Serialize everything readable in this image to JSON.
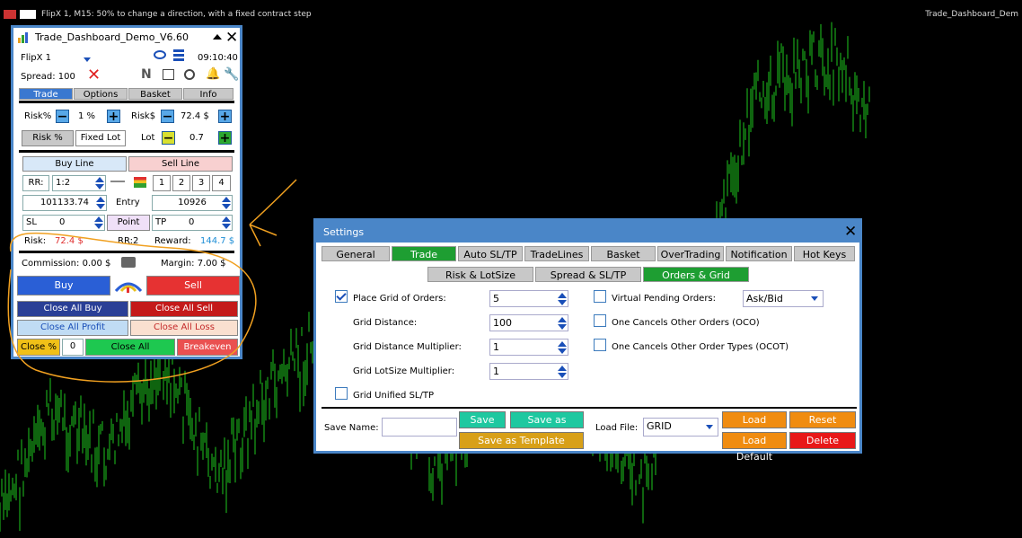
{
  "topbar": {
    "chart_title": "FlipX 1, M15: 50% to change a direction, with a fixed contract step",
    "right_label": "Trade_Dashboard_Dem"
  },
  "dashboard": {
    "title": "Trade_Dashboard_Demo_V6.60",
    "symbol": "FlipX 1",
    "time": "09:10:40",
    "spread": "Spread: 100",
    "news_icon": "N",
    "tabs": [
      "Trade",
      "Options",
      "Basket",
      "Info"
    ],
    "risk_pct_label": "Risk%",
    "risk_pct_value": "1 %",
    "risk_usd_label": "Risk$",
    "risk_usd_value": "72.4 $",
    "risk_mode_pct": "Risk %",
    "risk_mode_fixed": "Fixed Lot",
    "lot_label": "Lot",
    "lot_value": "0.7",
    "buy_line": "Buy Line",
    "sell_line": "Sell Line",
    "rr_label": "RR:",
    "rr_value": "1:2",
    "rr_buttons": [
      "1",
      "2",
      "3",
      "4"
    ],
    "entry_price": "101133.74",
    "entry_label": "Entry",
    "entry_right": "10926",
    "sl_label": "SL",
    "sl_value": "0",
    "point_label": "Point",
    "tp_label": "TP",
    "tp_value": "0",
    "risk_info_label": "Risk:",
    "risk_info_value": "72.4 $",
    "rr_info": "RR:2",
    "reward_label": "Reward:",
    "reward_value": "144.7 $",
    "commission": "Commission: 0.00 $",
    "margin": "Margin: 7.00 $",
    "buy": "Buy",
    "sell": "Sell",
    "close_all_buy": "Close All Buy",
    "close_all_sell": "Close All Sell",
    "close_all_profit": "Close All Profit",
    "close_all_loss": "Close All Loss",
    "close_pct": "Close %",
    "close_pct_value": "0",
    "close_all": "Close All",
    "breakeven": "Breakeven"
  },
  "settings": {
    "title": "Settings",
    "tabs": [
      "General",
      "Trade",
      "Auto SL/TP",
      "TradeLines",
      "Basket",
      "OverTrading",
      "Notification",
      "Hot Keys"
    ],
    "subtabs": [
      "Risk & LotSize",
      "Spread & SL/TP",
      "Orders & Grid"
    ],
    "place_grid": "Place Grid of Orders:",
    "place_grid_value": "5",
    "grid_distance": "Grid Distance:",
    "grid_distance_value": "100",
    "grid_distance_mult": "Grid Distance Multiplier:",
    "grid_distance_mult_value": "1",
    "grid_lot_mult": "Grid LotSize Multiplier:",
    "grid_lot_mult_value": "1",
    "grid_unified": "Grid Unified SL/TP",
    "virtual_pending": "Virtual Pending Orders:",
    "virtual_pending_value": "Ask/Bid",
    "oco": "One Cancels Other Orders (OCO)",
    "ocot": "One Cancels Other Order Types (OCOT)",
    "save_name_label": "Save Name:",
    "save": "Save",
    "save_default": "Save as Default",
    "save_template": "Save as Template",
    "load_file_label": "Load File:",
    "load_file_value": "GRID",
    "load": "Load",
    "reset": "Reset",
    "load_default": "Load Default",
    "delete": "Delete"
  },
  "colors": {
    "frame": "#4a86c8",
    "candle": "#1ec81e",
    "active_tab": "#1e9e32",
    "buy": "#2a5fd6",
    "sell": "#e63232",
    "annotation": "#f0a020"
  }
}
